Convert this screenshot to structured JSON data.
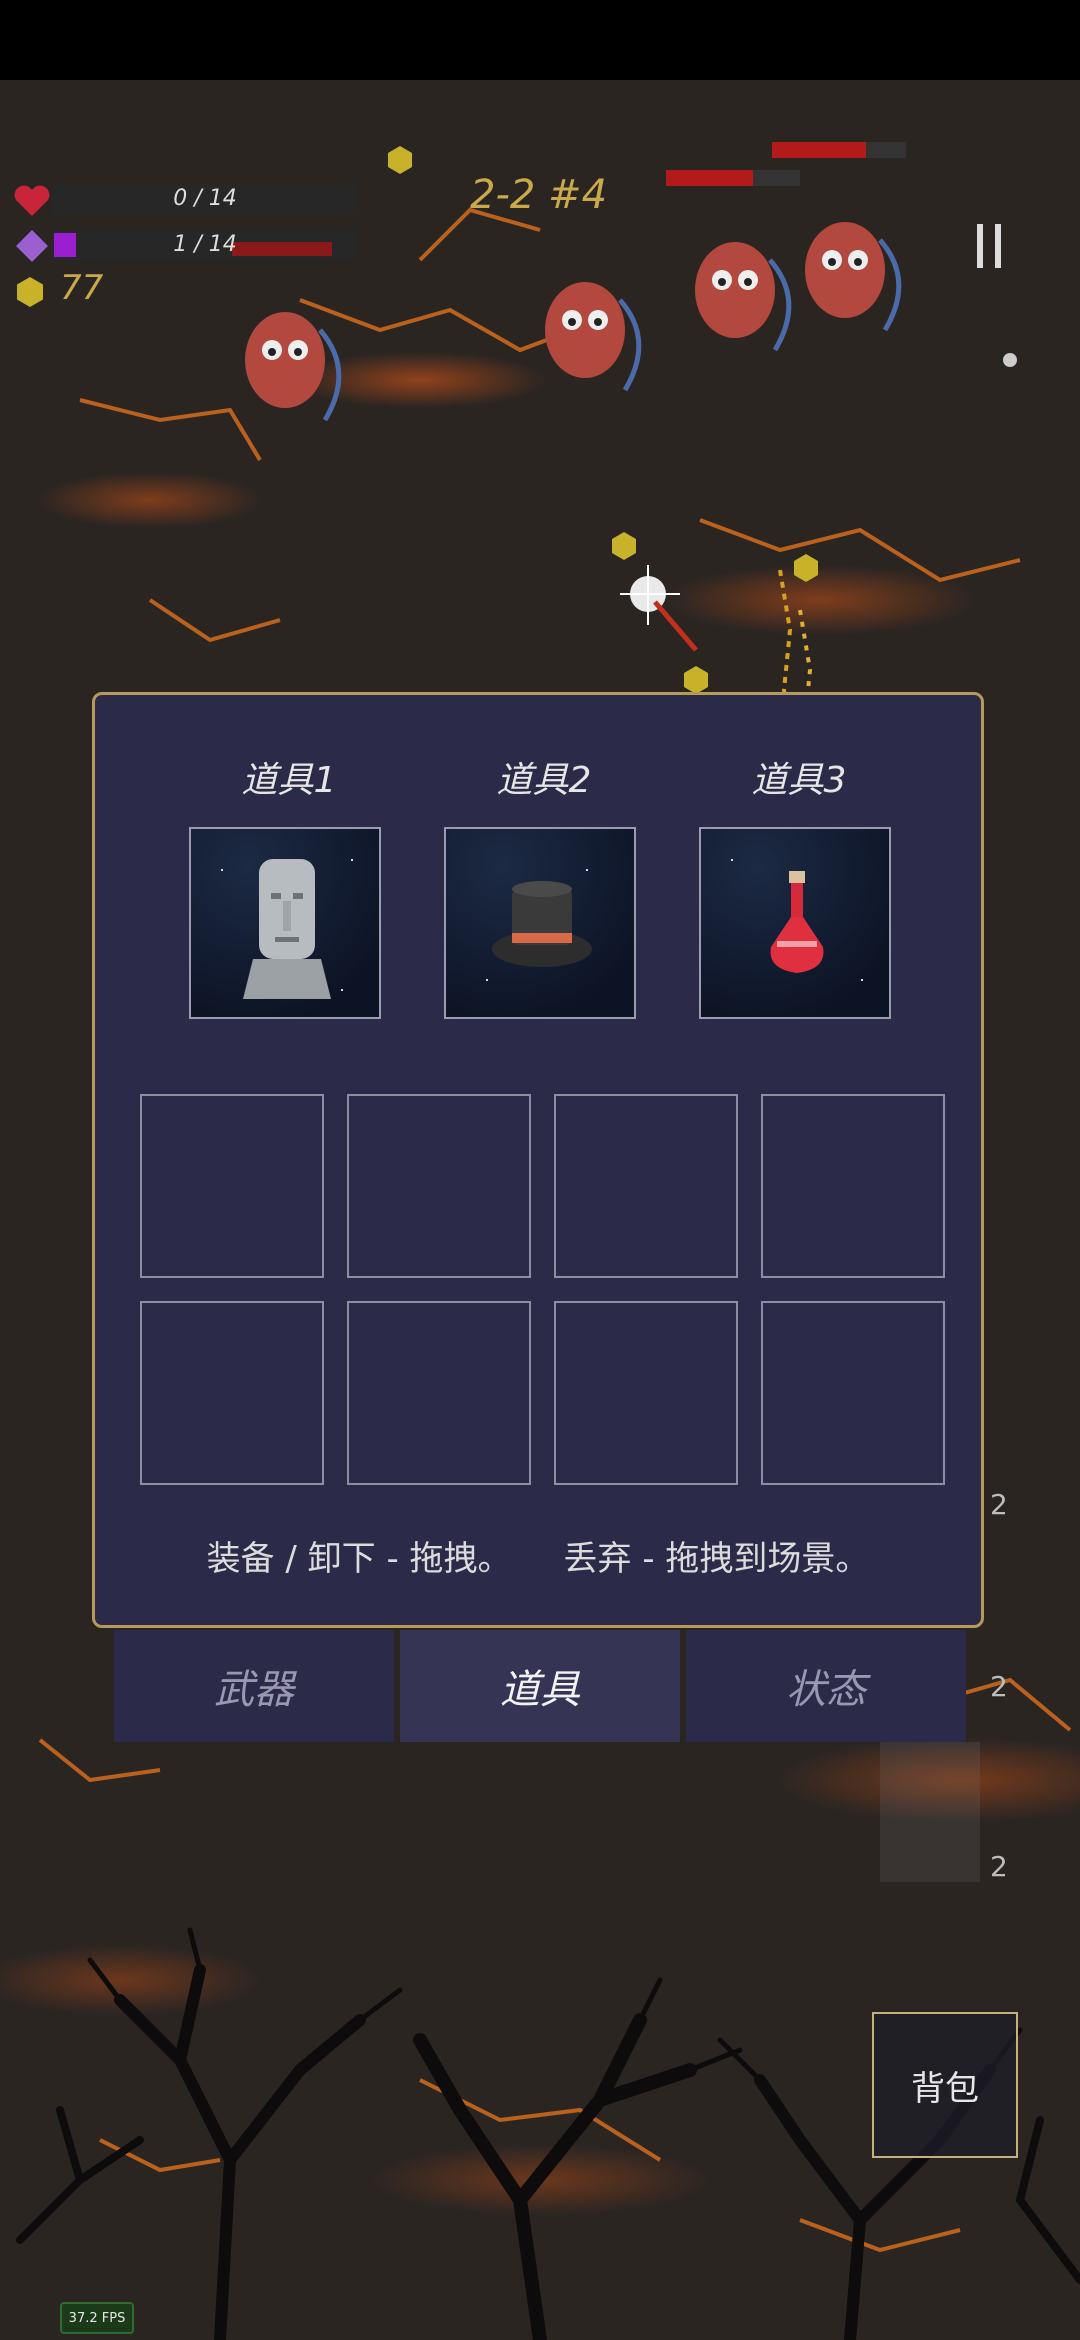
{
  "hud": {
    "hp_text": "0 / 14",
    "mana_text": "1 / 14",
    "coins": "77",
    "level": "2-2 #4"
  },
  "inventory": {
    "slot_titles": [
      "道具1",
      "道具2",
      "道具3"
    ],
    "slot_items": [
      "moai-statue-icon",
      "top-hat-icon",
      "red-potion-icon"
    ],
    "hint_equip": "装备 / 卸下 - 拖拽。",
    "hint_drop": "丢弃 - 拖拽到场景。"
  },
  "tabs": {
    "weapon": "武器",
    "items": "道具",
    "status": "状态",
    "active": "道具"
  },
  "side_counts": [
    "2",
    "2",
    "2"
  ],
  "bag_label": "背包",
  "fps": "37.2 FPS",
  "colors": {
    "panel_bg": "#2b2a48",
    "panel_border": "#b59a5a",
    "gold_text": "#c9a94a",
    "hp_red": "#b31b1b",
    "mana_purple": "#9b1fd0"
  }
}
